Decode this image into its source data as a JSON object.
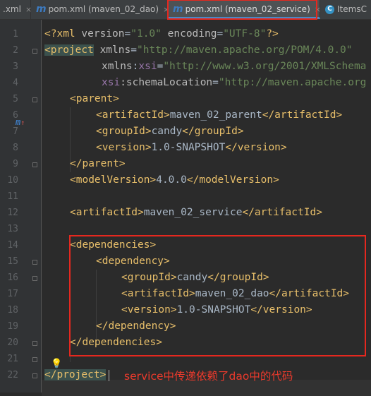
{
  "tabs": [
    {
      "label": ".xml",
      "icon": "",
      "active": false,
      "closable": true
    },
    {
      "label": "pom.xml (maven_02_dao)",
      "icon": "maven-icon",
      "active": false,
      "closable": true
    },
    {
      "label": "pom.xml (maven_02_service)",
      "icon": "maven-icon",
      "active": true,
      "closable": true
    },
    {
      "label": "ItemsC",
      "icon": "class-icon",
      "active": false,
      "closable": false
    }
  ],
  "icon_glyphs": {
    "maven": "m",
    "class": "C",
    "close": "×",
    "bulb": "💡",
    "arrow_up": "↑"
  },
  "line_numbers": [
    "1",
    "2",
    "3",
    "4",
    "5",
    "6",
    "7",
    "8",
    "9",
    "10",
    "11",
    "12",
    "13",
    "14",
    "15",
    "16",
    "17",
    "18",
    "19",
    "20",
    "21",
    "22"
  ],
  "code": {
    "l1": {
      "a": "<?xml ",
      "b": "version",
      "c": "=",
      "d": "\"1.0\"",
      "e": " ",
      "f": "encoding",
      "g": "=",
      "h": "\"UTF-8\"",
      "i": "?>"
    },
    "l2": {
      "a": "<project",
      "b": " xmlns",
      "c": "=",
      "d": "\"http://maven.apache.org/POM/4.0.0\""
    },
    "l3": {
      "a": "xmlns",
      "b": ":",
      "c": "xsi",
      "d": "=",
      "e": "\"http://www.w3.org/2001/XMLSchema"
    },
    "l4": {
      "a": "xsi",
      "b": ":schemaLocation",
      "c": "=",
      "d": "\"http://maven.apache.org"
    },
    "l5": {
      "a": "<parent>"
    },
    "l6": {
      "a": "<artifactId>",
      "b": "maven_02_parent",
      "c": "</artifactId>"
    },
    "l7": {
      "a": "<groupId>",
      "b": "candy",
      "c": "</groupId>"
    },
    "l8": {
      "a": "<version>",
      "b": "1.0-SNAPSHOT",
      "c": "</version>"
    },
    "l9": {
      "a": "</parent>"
    },
    "l10": {
      "a": "<modelVersion>",
      "b": "4.0.0",
      "c": "</modelVersion>"
    },
    "l12": {
      "a": "<artifactId>",
      "b": "maven_02_service",
      "c": "</artifactId>"
    },
    "l14": {
      "a": "<dependencies>"
    },
    "l15": {
      "a": "<dependency>"
    },
    "l16": {
      "a": "<groupId>",
      "b": "candy",
      "c": "</groupId>"
    },
    "l17": {
      "a": "<artifactId>",
      "b": "maven_02_dao",
      "c": "</artifactId>"
    },
    "l18": {
      "a": "<version>",
      "b": "1.0-SNAPSHOT",
      "c": "</version>"
    },
    "l19": {
      "a": "</dependency>"
    },
    "l20": {
      "a": "</dependencies>"
    },
    "l22": {
      "a": "</project>"
    }
  },
  "annotation": {
    "text": "service中传递依赖了dao中的代码",
    "color": "#e5281f"
  },
  "colors": {
    "background": "#2b2b2b",
    "tag": "#e8bf6a",
    "attribute": "#bababa",
    "string": "#6a8759",
    "namespace": "#9876aa",
    "text": "#a9b7c6",
    "highlight_box": "#e5281f"
  }
}
